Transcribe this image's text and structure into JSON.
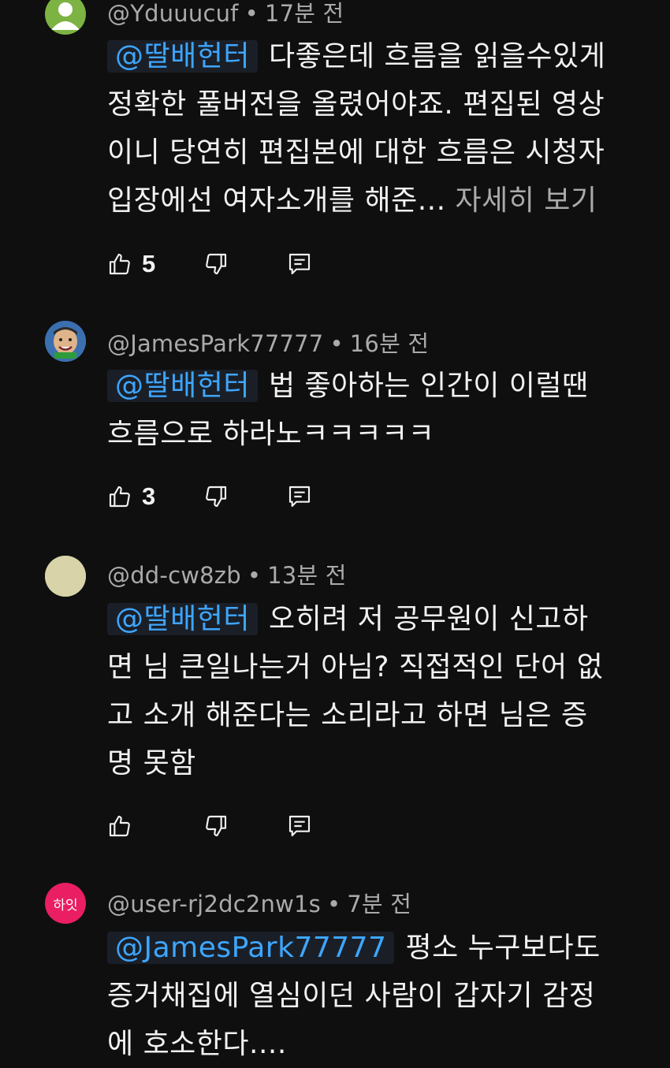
{
  "comments": [
    {
      "author": "@Yduuucuf",
      "time": "17분 전",
      "mention": "@딸배헌터",
      "lines": [
        "다좋은데 흐름을 읽을수있게",
        "정확한 풀버전을 올렸어야죠. 편집된 영상",
        "이니 당연히 편집본에 대한 흐름은 시청자",
        "입장에선 여자소개를 해준..."
      ],
      "more": "자세히 보기",
      "likes": "5",
      "avatar_color": "#7cb342"
    },
    {
      "author": "@JamesPark77777",
      "time": "16분 전",
      "mention": "@딸배헌터",
      "lines": [
        "법 좋아하는 인간이 이럴땐",
        "흐름으로 하라노ㅋㅋㅋㅋㅋ"
      ],
      "likes": "3",
      "avatar_color": "#3b6fb0"
    },
    {
      "author": "@dd-cw8zb",
      "time": "13분 전",
      "mention": "@딸배헌터",
      "lines": [
        "오히려  저 공무원이 신고하",
        "면 님 큰일나는거 아님? 직접적인 단어 없",
        "고 소개 해준다는 소리라고 하면 님은 증",
        "명 못함"
      ],
      "likes": "",
      "avatar_color": "#d8d3a8"
    },
    {
      "author": "@user-rj2dc2nw1s",
      "time": "7분 전",
      "mention": "@JamesPark77777",
      "lines": [
        "평소 누구보다도",
        "증거채집에 열심이던 사람이 갑자기 감정",
        "에 호소한다...."
      ],
      "avatar_text": "하잇",
      "avatar_color": "#e91e63"
    }
  ],
  "icons": {
    "like": "thumb-up-icon",
    "dislike": "thumb-down-icon",
    "reply": "reply-icon"
  }
}
